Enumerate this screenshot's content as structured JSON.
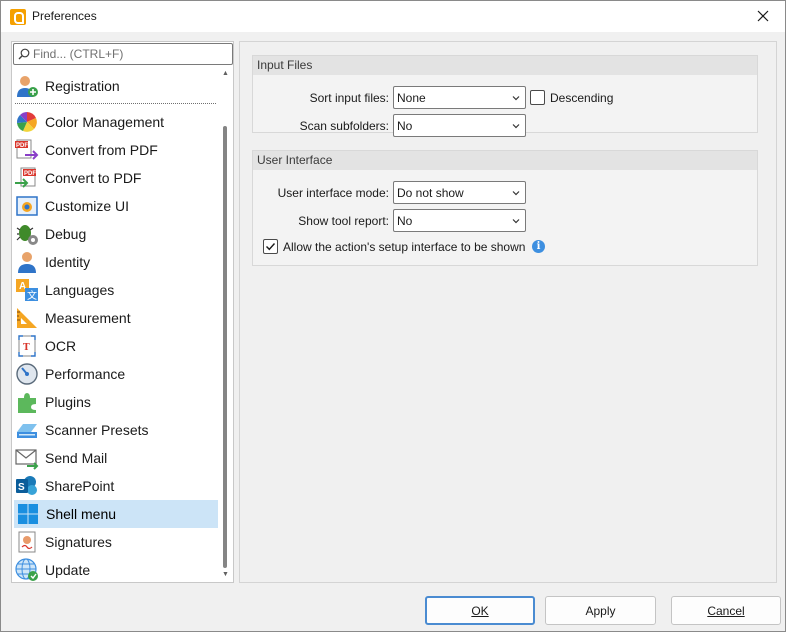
{
  "window": {
    "title": "Preferences"
  },
  "search": {
    "placeholder": "Find... (CTRL+F)"
  },
  "sidebar": {
    "items": [
      {
        "label": "Registration",
        "icon": "registration-user-icon"
      },
      {
        "label": "Color Management",
        "icon": "color-wheel-icon"
      },
      {
        "label": "Convert from PDF",
        "icon": "convert-from-pdf-icon"
      },
      {
        "label": "Convert to PDF",
        "icon": "convert-to-pdf-icon"
      },
      {
        "label": "Customize UI",
        "icon": "customize-ui-icon"
      },
      {
        "label": "Debug",
        "icon": "debug-bug-icon"
      },
      {
        "label": "Identity",
        "icon": "identity-user-icon"
      },
      {
        "label": "Languages",
        "icon": "languages-icon"
      },
      {
        "label": "Measurement",
        "icon": "ruler-icon"
      },
      {
        "label": "OCR",
        "icon": "ocr-icon"
      },
      {
        "label": "Performance",
        "icon": "speedometer-icon"
      },
      {
        "label": "Plugins",
        "icon": "puzzle-icon"
      },
      {
        "label": "Scanner Presets",
        "icon": "scanner-icon"
      },
      {
        "label": "Send Mail",
        "icon": "mail-icon"
      },
      {
        "label": "SharePoint",
        "icon": "sharepoint-icon"
      },
      {
        "label": "Shell menu",
        "icon": "windows-logo-icon",
        "selected": true
      },
      {
        "label": "Signatures",
        "icon": "signature-icon"
      },
      {
        "label": "Update",
        "icon": "globe-update-icon"
      }
    ]
  },
  "input_files": {
    "header": "Input Files",
    "sort_label": "Sort input files:",
    "sort_value": "None",
    "descending_label": "Descending",
    "descending_checked": false,
    "scan_label": "Scan subfolders:",
    "scan_value": "No"
  },
  "user_interface": {
    "header": "User Interface",
    "mode_label": "User interface mode:",
    "mode_value": "Do not show",
    "report_label": "Show tool report:",
    "report_value": "No",
    "allow_label": "Allow the action's setup interface to be shown",
    "allow_checked": true,
    "info_glyph": "i"
  },
  "footer": {
    "ok": "OK",
    "apply": "Apply",
    "cancel": "Cancel"
  },
  "colors": {
    "selection": "#cce4f7",
    "accent": "#4a8bd1",
    "info": "#3d8fe0"
  }
}
